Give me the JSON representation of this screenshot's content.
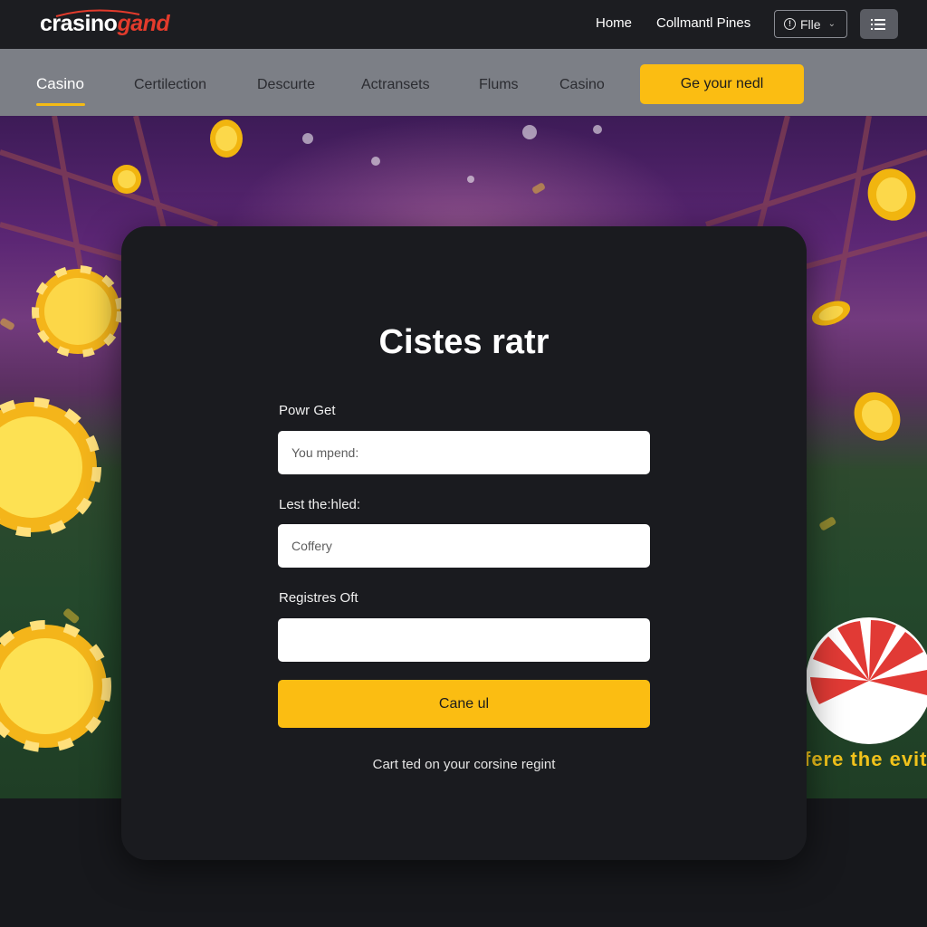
{
  "header": {
    "logo_part1": "crasino",
    "logo_part2": "gand",
    "links": [
      "Home",
      "Collmantl Pines"
    ],
    "file_select": "Flle",
    "colors": {
      "accent": "#fbbd12",
      "logo_red": "#e33b2c",
      "header_bg": "#1c1d21",
      "nav_bg": "#7c7f86"
    }
  },
  "nav": {
    "items": [
      "Casino",
      "Certilection",
      "Descurte",
      "Actransets",
      "Flums",
      "Casino"
    ],
    "active": "Casino",
    "cta": "Ge your nedl"
  },
  "form": {
    "title": "Cistes ratr",
    "fields": [
      {
        "label": "Powr Get",
        "placeholder": "You mpend:"
      },
      {
        "label": "Lest the:hled:",
        "placeholder": "Coffery"
      },
      {
        "label": "Registres Oft",
        "placeholder": ""
      }
    ],
    "submit": "Cane ul",
    "footnote": "Cart ted on your corsine regint"
  },
  "side_banner_text": "fere the evit",
  "icons": [
    "info-icon",
    "chevron-down-icon",
    "list-menu-icon",
    "casino-chip-icon",
    "roulette-wheel-icon"
  ]
}
